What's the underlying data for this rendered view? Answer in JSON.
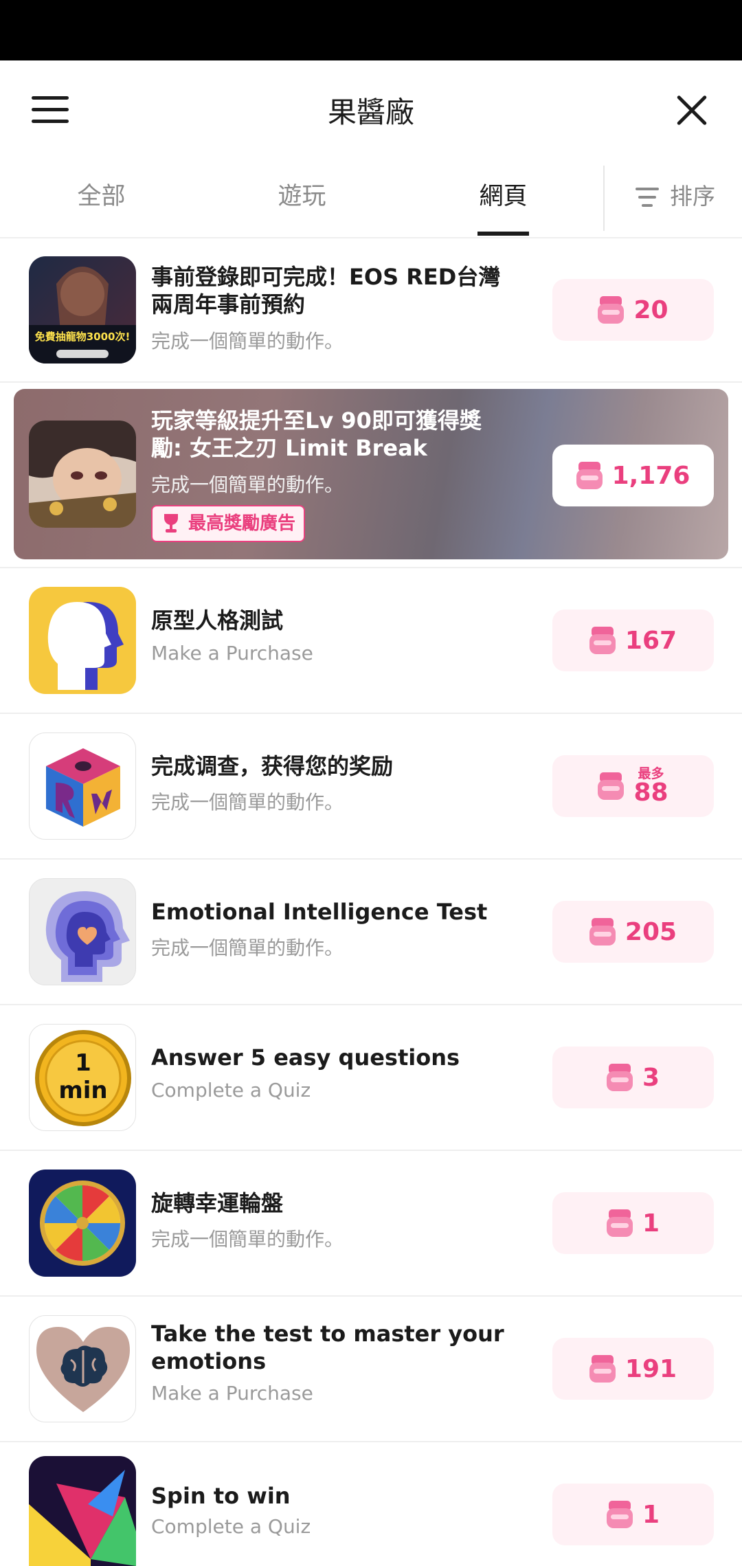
{
  "header": {
    "title": "果醬廠"
  },
  "tabs": [
    {
      "label": "全部"
    },
    {
      "label": "遊玩"
    },
    {
      "label": "網頁",
      "active": true
    }
  ],
  "sort": {
    "label": "排序"
  },
  "items": [
    {
      "title": "事前登錄即可完成！EOS RED台灣兩周年事前預約",
      "subtitle": "完成一個簡單的動作。",
      "reward": "20",
      "image_text": "免費抽龍物3000次!"
    },
    {
      "title": "玩家等級提升至Lv 90即可獲得獎勵: 女王之刃 Limit Break",
      "subtitle": "完成一個簡單的動作。",
      "reward": "1,176",
      "badge": "最高獎勵廣告",
      "featured": true
    },
    {
      "title": "原型人格測試",
      "subtitle": "Make a Purchase",
      "reward": "167"
    },
    {
      "title": "完成调查，获得您的奖励",
      "subtitle": "完成一個簡單的動作。",
      "reward_prefix": "最多",
      "reward": "88"
    },
    {
      "title": "Emotional Intelligence Test",
      "subtitle": "完成一個簡單的動作。",
      "reward": "205"
    },
    {
      "title": "Answer 5 easy questions",
      "subtitle": "Complete a Quiz",
      "reward": "3",
      "image_text": "1 min"
    },
    {
      "title": "旋轉幸運輪盤",
      "subtitle": "完成一個簡單的動作。",
      "reward": "1"
    },
    {
      "title": "Take the test to master your emotions",
      "subtitle": "Make a Purchase",
      "reward": "191"
    },
    {
      "title": "Spin to win",
      "subtitle": "Complete a Quiz",
      "reward": "1"
    }
  ],
  "colors": {
    "accent": "#ea3f7e",
    "reward_bg": "#fff1f5",
    "statusbar": "#000000"
  }
}
